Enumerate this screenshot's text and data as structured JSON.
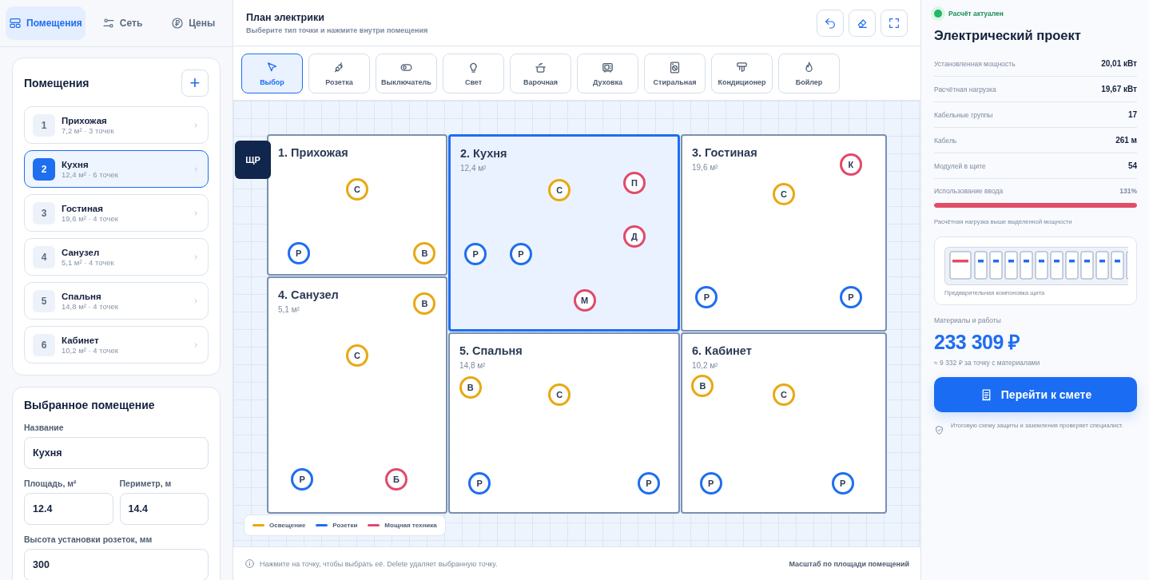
{
  "sidebar": {
    "tabs": [
      {
        "label": "Помещения",
        "selected": true
      },
      {
        "label": "Сеть",
        "selected": false
      },
      {
        "label": "Цены",
        "selected": false
      }
    ],
    "rooms_card": {
      "title": "Помещения",
      "add_button": "+",
      "rooms": [
        {
          "number": "1",
          "name": "Прихожая",
          "meta": "7,2 м² · 3 точек",
          "selected": false
        },
        {
          "number": "2",
          "name": "Кухня",
          "meta": "12,4 м² · 6 точек",
          "selected": true
        },
        {
          "number": "3",
          "name": "Гостиная",
          "meta": "19,6 м² · 4 точек",
          "selected": false
        },
        {
          "number": "4",
          "name": "Санузел",
          "meta": "5,1 м² · 4 точек",
          "selected": false
        },
        {
          "number": "5",
          "name": "Спальня",
          "meta": "14,8 м² · 4 точек",
          "selected": false
        },
        {
          "number": "6",
          "name": "Кабинет",
          "meta": "10,2 м² · 4 точек",
          "selected": false
        }
      ]
    },
    "selected_room": {
      "title": "Выбранное помещение",
      "fields": [
        {
          "label": "Название",
          "value": "Кухня"
        },
        {
          "label": "Площадь, м²",
          "value": "12.4"
        },
        {
          "label": "Периметр, м",
          "value": "14.4"
        },
        {
          "label": "Высота установки розеток, мм",
          "value": "300"
        }
      ]
    }
  },
  "header": {
    "title": "План электрики",
    "subtitle": "Выберите тип точки и нажмите внутри помещения"
  },
  "tools": [
    {
      "label": "Выбор",
      "selected": true
    },
    {
      "label": "Розетка",
      "selected": false
    },
    {
      "label": "Выключатель",
      "selected": false
    },
    {
      "label": "Свет",
      "selected": false
    },
    {
      "label": "Варочная",
      "selected": false
    },
    {
      "label": "Духовка",
      "selected": false
    },
    {
      "label": "Стиральная",
      "selected": false
    },
    {
      "label": "Кондиционер",
      "selected": false
    },
    {
      "label": "Бойлер",
      "selected": false
    }
  ],
  "plan": {
    "panel_badge": "ЩР",
    "rooms": [
      {
        "title": "1. Прихожая",
        "selected": false,
        "points": [
          {
            "label": "С",
            "kind": "light"
          },
          {
            "label": "Р",
            "kind": "socket"
          },
          {
            "label": "В",
            "kind": "light"
          }
        ]
      },
      {
        "title": "2. Кухня",
        "area": "12,4 м²",
        "selected": true,
        "points": [
          {
            "label": "С",
            "kind": "light"
          },
          {
            "label": "П",
            "kind": "power"
          },
          {
            "label": "Р",
            "kind": "socket"
          },
          {
            "label": "Р",
            "kind": "socket"
          },
          {
            "label": "Д",
            "kind": "power"
          },
          {
            "label": "М",
            "kind": "power"
          }
        ]
      },
      {
        "title": "3. Гостиная",
        "area": "19,6 м²",
        "selected": false,
        "points": [
          {
            "label": "К",
            "kind": "power"
          },
          {
            "label": "С",
            "kind": "light"
          },
          {
            "label": "Р",
            "kind": "socket"
          },
          {
            "label": "Р",
            "kind": "socket"
          }
        ]
      },
      {
        "title": "4. Санузел",
        "area": "5,1 м²",
        "selected": false,
        "points": [
          {
            "label": "В",
            "kind": "light"
          },
          {
            "label": "С",
            "kind": "light"
          },
          {
            "label": "Р",
            "kind": "socket"
          },
          {
            "label": "Б",
            "kind": "power"
          }
        ]
      },
      {
        "title": "5. Спальня",
        "area": "14,8 м²",
        "selected": false,
        "points": [
          {
            "label": "В",
            "kind": "light"
          },
          {
            "label": "С",
            "kind": "light"
          },
          {
            "label": "Р",
            "kind": "socket"
          },
          {
            "label": "Р",
            "kind": "socket"
          }
        ]
      },
      {
        "title": "6. Кабинет",
        "area": "10,2 м²",
        "selected": false,
        "points": [
          {
            "label": "В",
            "kind": "light"
          },
          {
            "label": "С",
            "kind": "light"
          },
          {
            "label": "Р",
            "kind": "socket"
          },
          {
            "label": "Р",
            "kind": "socket"
          }
        ]
      }
    ],
    "legend": [
      {
        "label": "Освещение",
        "kind": "light"
      },
      {
        "label": "Розетки",
        "kind": "socket"
      },
      {
        "label": "Мощная техника",
        "kind": "power"
      }
    ]
  },
  "footer": {
    "hint": "Нажмите на точку, чтобы выбрать её. Delete удаляет выбранную точку.",
    "scale": "Масштаб по площади помещений"
  },
  "summary": {
    "status": {
      "text": "Расчёт актуален",
      "ok": true
    },
    "title": "Электрический проект",
    "stats": [
      {
        "label": "Установленная мощность",
        "value": "20,01 кВт"
      },
      {
        "label": "Расчётная нагрузка",
        "value": "19,67 кВт"
      },
      {
        "label": "Кабельные группы",
        "value": "17"
      },
      {
        "label": "Кабель",
        "value": "261 м"
      },
      {
        "label": "Модулей в щите",
        "value": "54"
      }
    ],
    "usage": {
      "label": "Использование ввода",
      "value": "131%",
      "level": 1,
      "overload": true
    },
    "warning": "Расчётная нагрузка выше выделенной мощности",
    "panel_caption": "Предварительная компоновка щита",
    "cost_label": "Материалы и работы",
    "cost": "233 309 ₽",
    "per_point": "≈ 9 332 ₽ за точку с материалами",
    "estimate_button": "Перейти к смете",
    "note": "Итоговую схему защиты и заземления проверяет специалист."
  }
}
